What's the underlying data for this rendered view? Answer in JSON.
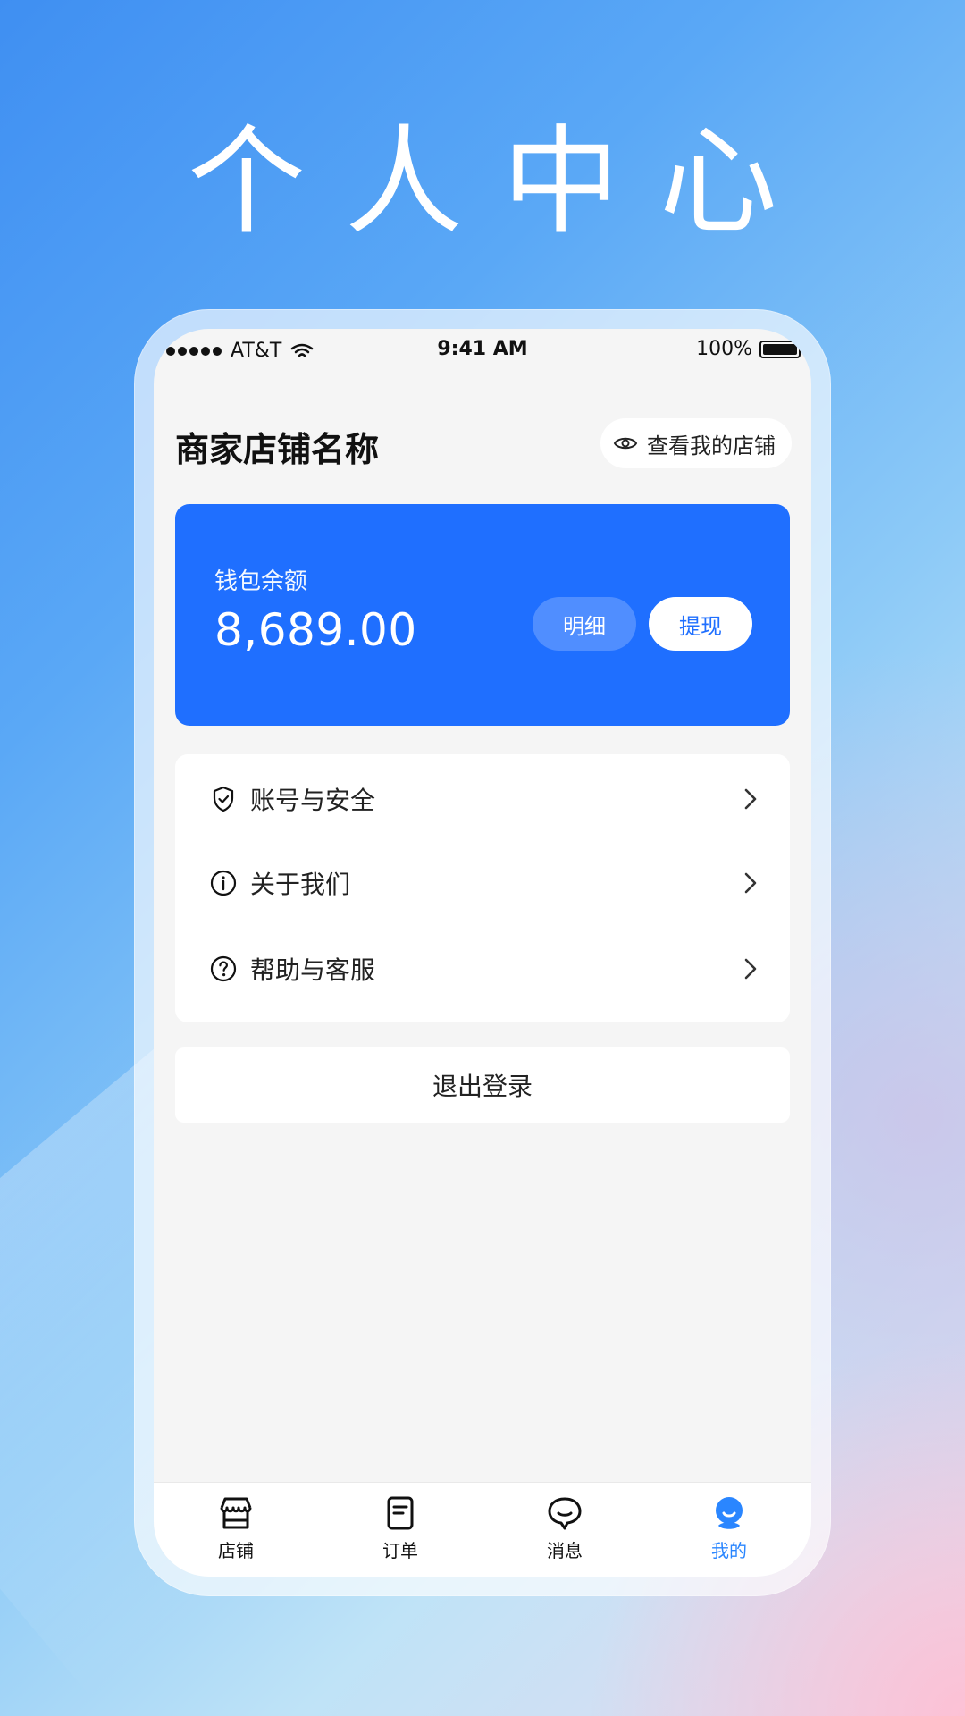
{
  "hero": {
    "title": "个人中心"
  },
  "status_bar": {
    "carrier": "AT&T",
    "time": "9:41 AM",
    "battery_percent": "100%"
  },
  "header": {
    "store_name": "商家店铺名称",
    "view_store_label": "查看我的店铺"
  },
  "wallet": {
    "label": "钱包余额",
    "amount": "8,689.00",
    "detail_button": "明细",
    "withdraw_button": "提现",
    "accent_color": "#1f6fff"
  },
  "menu": {
    "items": [
      {
        "label": "账号与安全",
        "icon": "shield-check-icon"
      },
      {
        "label": "关于我们",
        "icon": "info-circle-icon"
      },
      {
        "label": "帮助与客服",
        "icon": "question-circle-icon"
      }
    ]
  },
  "logout": {
    "label": "退出登录"
  },
  "tabbar": {
    "tabs": [
      {
        "label": "店铺",
        "icon": "store-icon",
        "active": false
      },
      {
        "label": "订单",
        "icon": "order-list-icon",
        "active": false
      },
      {
        "label": "消息",
        "icon": "message-bubble-icon",
        "active": false
      },
      {
        "label": "我的",
        "icon": "profile-icon",
        "active": true
      }
    ],
    "active_color": "#2a86ff"
  }
}
